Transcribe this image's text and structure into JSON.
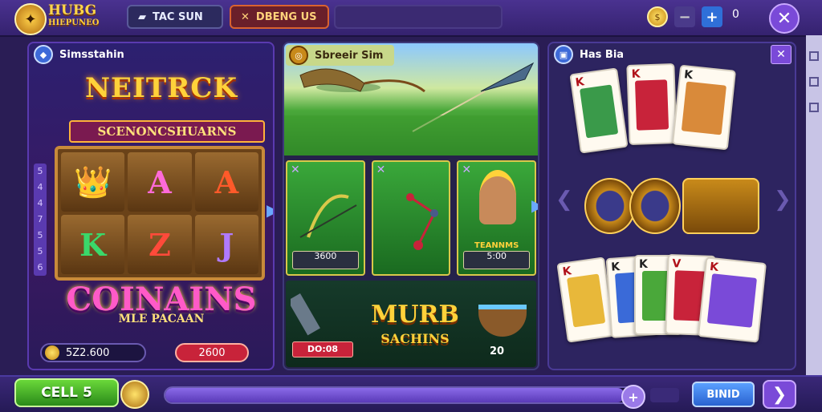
{
  "header": {
    "brand_line1": "HUBG",
    "brand_line2": "HIEPUNEO",
    "tab1_label": "TAC SUN",
    "tab2_label": "DBENG US",
    "tab1_icon": "card-icon",
    "tab2_icon": "cross-swords-icon",
    "counter": "0"
  },
  "slot_panel": {
    "title": "Simsstahin",
    "game_title": "NEITRCK",
    "game_subtitle": "SCENONCSHUARNS",
    "reels": [
      "👑",
      "A",
      "A",
      "K",
      "Z",
      "J"
    ],
    "paylines": [
      "5",
      "4",
      "4",
      "7",
      "5",
      "5",
      "6"
    ],
    "banner_title": "COINAINS",
    "banner_sub": "MLE PACAAN",
    "balance": "5Z2.600",
    "bet": "2600"
  },
  "hunting_panel": {
    "title": "Sbreeir Sim",
    "cards": [
      {
        "price": "3600",
        "price_label": "",
        "label": ""
      },
      {
        "price": "",
        "price_label": "",
        "label": ""
      },
      {
        "price": "5:00",
        "price_label": "",
        "label": "TEANNMS"
      }
    ],
    "banner_line1": "MURB",
    "banner_line2": "SACHINS",
    "bottom_left": "DO:08",
    "bottom_right": "20"
  },
  "card_panel": {
    "title": "Has Bia"
  },
  "footer": {
    "green_button": "CELL",
    "green_button_suffix": "5",
    "bind_button": "BINID",
    "progress": 0.96
  },
  "colors": {
    "accent": "#7a4ad8",
    "gold": "#ffd23a",
    "green": "#4ab82a",
    "red": "#c8233a"
  }
}
